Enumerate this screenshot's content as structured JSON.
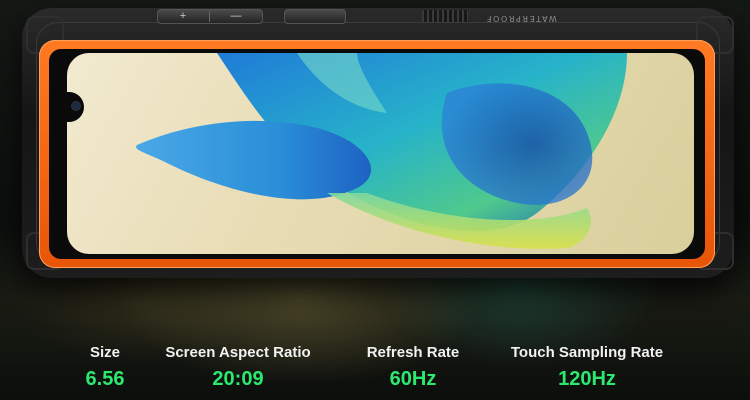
{
  "device": {
    "edge_label": "WATERPROOF",
    "volume_up_symbol": "+",
    "volume_down_symbol": "—",
    "frame_color": "#f26a16"
  },
  "specs": [
    {
      "label": "Size",
      "value": "6.56"
    },
    {
      "label": "Screen Aspect Ratio",
      "value": "20:09"
    },
    {
      "label": "Refresh Rate",
      "value": "60Hz"
    },
    {
      "label": "Touch Sampling Rate",
      "value": "120Hz"
    }
  ],
  "colors": {
    "value_text": "#2ce86f",
    "label_text": "#f1f1f1",
    "background": "#0b0f0d"
  }
}
